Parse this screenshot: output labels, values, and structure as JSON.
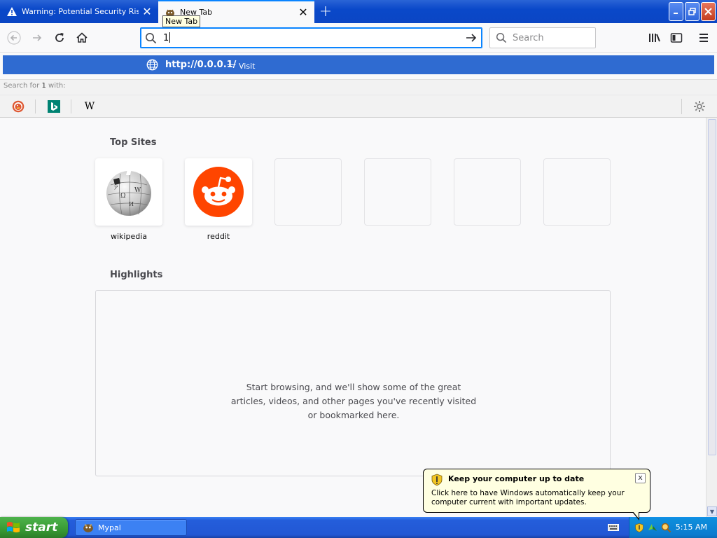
{
  "tabs": [
    {
      "title": "Warning: Potential Security Risk A",
      "icon": "warning-icon",
      "active": false
    },
    {
      "title": "New Tab",
      "icon": "mypal-icon",
      "active": true
    }
  ],
  "tooltip": "New Tab",
  "navbar": {
    "url_value": "1",
    "search_placeholder": "Search"
  },
  "autocomplete": {
    "url": "http://0.0.0.1/",
    "dash": "—",
    "action": "Visit",
    "search_for_prefix": "Search for",
    "search_term": "1",
    "search_for_suffix": "with:",
    "engines": [
      "duckduckgo-icon",
      "bing-icon",
      "wikipedia-icon"
    ],
    "wikipedia_letter": "W"
  },
  "topsites": {
    "title": "Top Sites",
    "tiles": [
      {
        "label": "wikipedia",
        "icon": "wikipedia-globe-icon"
      },
      {
        "label": "reddit",
        "icon": "reddit-icon"
      },
      {
        "label": "",
        "icon": ""
      },
      {
        "label": "",
        "icon": ""
      },
      {
        "label": "",
        "icon": ""
      },
      {
        "label": "",
        "icon": ""
      }
    ]
  },
  "highlights": {
    "title": "Highlights",
    "message": "Start browsing, and we'll show some of the great articles, videos, and other pages you've recently visited or bookmarked here."
  },
  "balloon": {
    "title": "Keep your computer up to date",
    "body": "Click here to have Windows automatically keep your computer current with important updates.",
    "close": "x"
  },
  "taskbar": {
    "start_label": "start",
    "task_label": "Mypal",
    "clock": "5:15 AM"
  },
  "colors": {
    "accent": "#0a84ff",
    "autocomplete_highlight": "#2f6bd1",
    "reddit": "#ff4500",
    "xp_blue": "#245edb",
    "xp_green": "#389a34"
  }
}
